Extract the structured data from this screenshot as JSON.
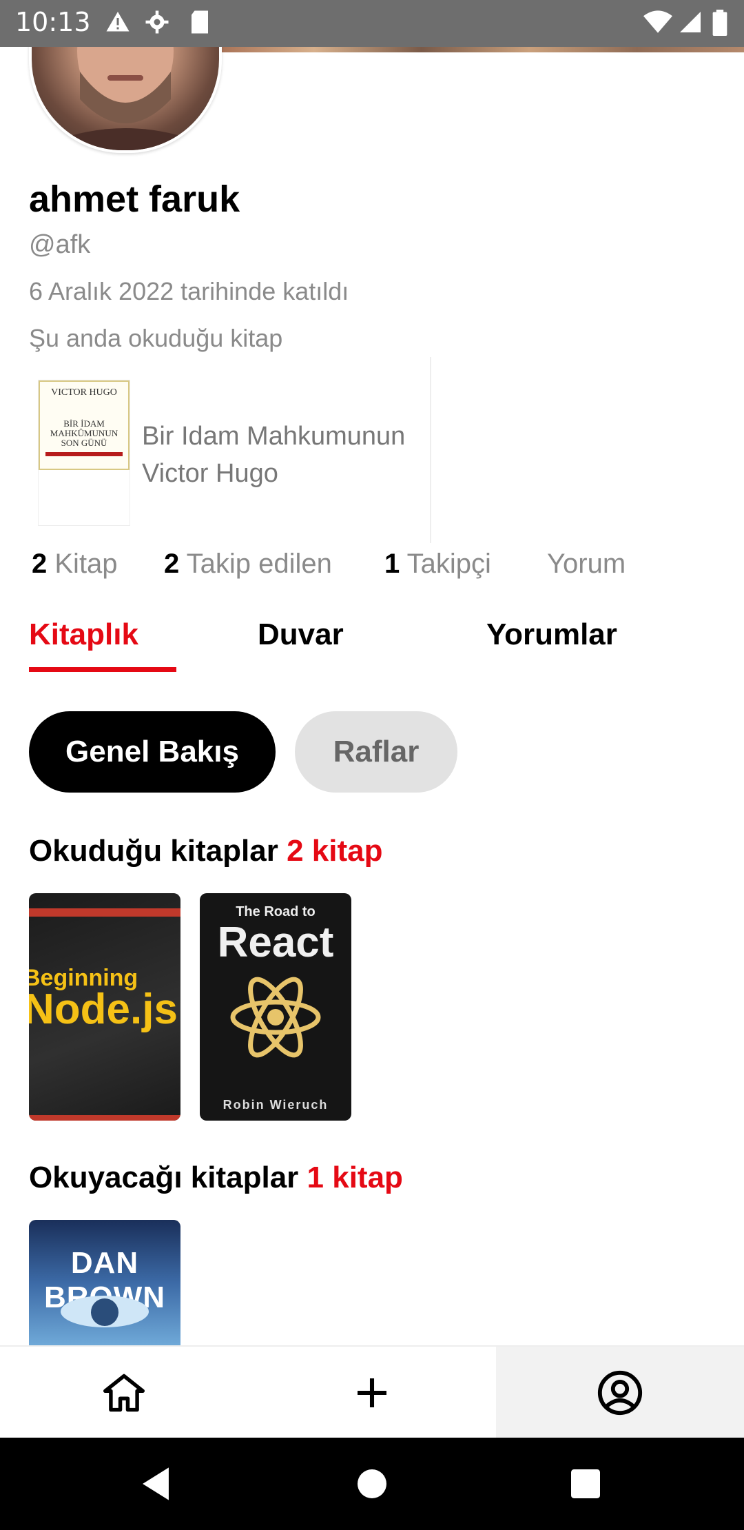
{
  "status_bar": {
    "time": "10:13"
  },
  "profile": {
    "name": "ahmet faruk",
    "handle": "@afk",
    "joined": "6 Aralık 2022 tarihinde katıldı",
    "currently_reading_label": "Şu anda okuduğu kitap",
    "current_book": {
      "cover_author": "VICTOR HUGO",
      "cover_title": "BİR İDAM MAHKÛMUNUN SON GÜNÜ",
      "title": "Bir Idam Mahkumunun",
      "author": "Victor Hugo"
    }
  },
  "stats": [
    {
      "count": "2",
      "label": "Kitap"
    },
    {
      "count": "2",
      "label": "Takip edilen"
    },
    {
      "count": "1",
      "label": "Takipçi"
    },
    {
      "count": "",
      "label": "Yorum"
    }
  ],
  "tabs": [
    {
      "label": "Kitaplık",
      "active": true
    },
    {
      "label": "Duvar",
      "active": false
    },
    {
      "label": "Yorumlar",
      "active": false
    }
  ],
  "filters": {
    "overview": "Genel Bakış",
    "shelves": "Raflar"
  },
  "reading_section": {
    "title": "Okuduğu kitaplar",
    "count": "2 kitap",
    "books": [
      {
        "cover_line1": "Beginning",
        "cover_line2": "Node.js"
      },
      {
        "cover_small": "The Road to",
        "cover_big": "React",
        "cover_author": "Robin Wieruch"
      }
    ]
  },
  "to_read_section": {
    "title": "Okuyacağı kitaplar",
    "count": "1 kitap",
    "books": [
      {
        "cover_text": "DAN BROWN"
      }
    ]
  },
  "bottom_nav": {
    "items": [
      "home-icon",
      "add-icon",
      "profile-icon"
    ],
    "active": "profile-icon"
  },
  "colors": {
    "accent": "#e50914",
    "primary_pill": "#000000",
    "secondary_pill": "#e2e2e2"
  }
}
